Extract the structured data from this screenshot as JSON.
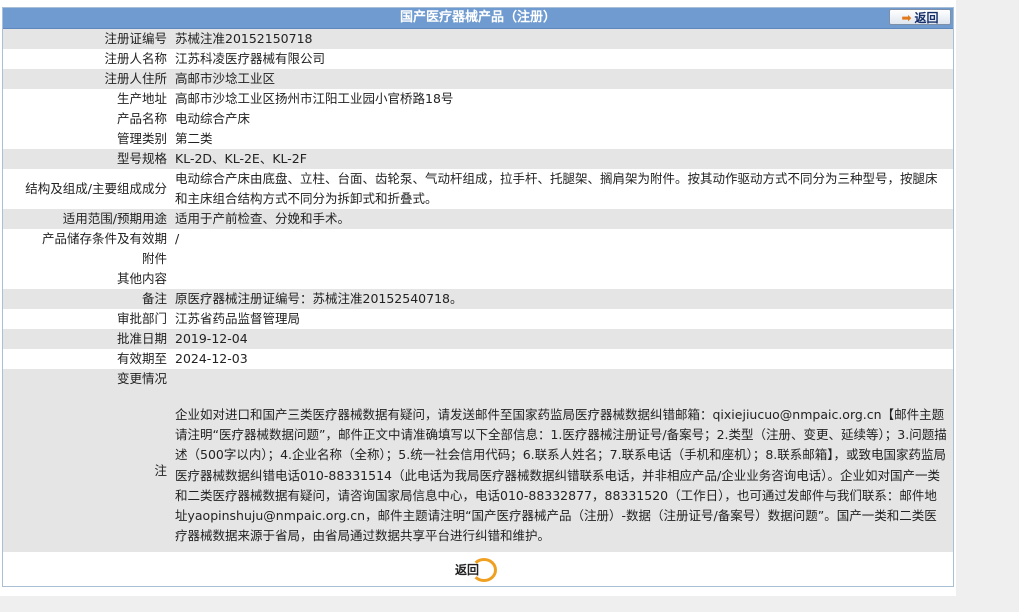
{
  "header": {
    "title": "国产医疗器械产品（注册）",
    "back_label": "返回"
  },
  "rows": [
    {
      "label": "注册证编号",
      "value": "苏械注准20152150718"
    },
    {
      "label": "注册人名称",
      "value": "江苏科凌医疗器械有限公司"
    },
    {
      "label": "注册人住所",
      "value": "高邮市沙埝工业区"
    },
    {
      "label": "生产地址",
      "value": "高邮市沙埝工业区扬州市江阳工业园小官桥路18号"
    },
    {
      "label": "产品名称",
      "value": "电动综合产床"
    },
    {
      "label": "管理类别",
      "value": "第二类"
    },
    {
      "label": "型号规格",
      "value": "KL-2D、KL-2E、KL-2F"
    },
    {
      "label": "结构及组成/主要组成成分",
      "value": "电动综合产床由底盘、立柱、台面、齿轮泵、气动杆组成，拉手杆、托腿架、搁肩架为附件。按其动作驱动方式不同分为三种型号，按腿床和主床组合结构方式不同分为拆卸式和折叠式。"
    },
    {
      "label": "适用范围/预期用途",
      "value": "适用于产前检查、分娩和手术。"
    },
    {
      "label": "产品储存条件及有效期",
      "value": "/"
    },
    {
      "label": "附件",
      "value": ""
    },
    {
      "label": "其他内容",
      "value": ""
    },
    {
      "label": "备注",
      "value": "原医疗器械注册证编号：苏械注准20152540718。"
    },
    {
      "label": "审批部门",
      "value": "江苏省药品监督管理局"
    },
    {
      "label": "批准日期",
      "value": "2019-12-04"
    },
    {
      "label": "有效期至",
      "value": "2024-12-03"
    },
    {
      "label": "变更情况",
      "value": ""
    }
  ],
  "note": {
    "label": "注",
    "text": "企业如对进口和国产三类医疗器械数据有疑问，请发送邮件至国家药监局医疗器械数据纠错邮箱：qixiejiucuo@nmpaic.org.cn【邮件主题请注明“医疗器械数据问题”，邮件正文中请准确填写以下全部信息：1.医疗器械注册证号/备案号；2.类型（注册、变更、延续等）；3.问题描述（500字以内）；4.企业名称（全称）；5.统一社会信用代码；6.联系人姓名；7.联系电话（手机和座机）；8.联系邮箱】，或致电国家药监局医疗器械数据纠错电话010-88331514（此电话为我局医疗器械数据纠错联系电话，并非相应产品/企业业务咨询电话）。企业如对国产一类和二类医疗器械数据有疑问，请咨询国家局信息中心，电话010-88332877，88331520（工作日），也可通过发邮件与我们联系：邮件地址yaopinshuju@nmpaic.org.cn，邮件主题请注明“国产医疗器械产品（注册）-数据（注册证号/备案号）数据问题”。国产一类和二类医疗器械数据来源于省局，由省局通过数据共享平台进行纠错和维护。"
  },
  "footer": {
    "back_label": "返回"
  },
  "colors": {
    "title_bar": "#6f9bd0",
    "row_gray": "#e5e5e5",
    "accent_orange": "#f0a020"
  }
}
